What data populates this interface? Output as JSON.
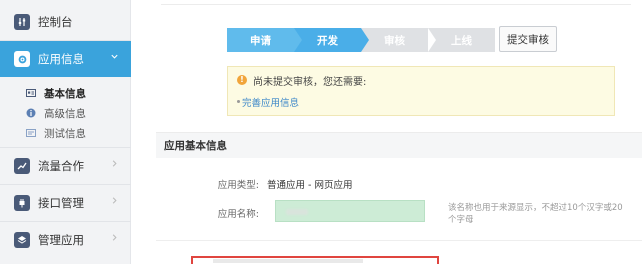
{
  "sidebar": {
    "items": [
      {
        "label": "控制台",
        "icon": "sliders-icon"
      },
      {
        "label": "应用信息",
        "icon": "gear-icon"
      },
      {
        "label": "流量合作",
        "icon": "chart-icon"
      },
      {
        "label": "接口管理",
        "icon": "plug-icon"
      },
      {
        "label": "管理应用",
        "icon": "layers-icon"
      }
    ],
    "sub_items": [
      {
        "label": "基本信息",
        "icon": "id-card-icon"
      },
      {
        "label": "高级信息",
        "icon": "info-icon"
      },
      {
        "label": "测试信息",
        "icon": "test-card-icon"
      }
    ]
  },
  "steps": [
    "申请",
    "开发",
    "审核",
    "上线"
  ],
  "submit_button": "提交审核",
  "notice": {
    "title": "尚未提交审核，您还需要:",
    "link": "完善应用信息"
  },
  "section": {
    "title": "应用基本信息",
    "type_label": "应用类型:",
    "type_value": "普通应用  -  网页应用",
    "name_label": "应用名称:",
    "name_hint": "该名称也用于来源显示，不超过10个汉字或20个字母"
  },
  "colors": {
    "accent": "#3aa3dc",
    "step_done": "#60bbec",
    "step_todo": "#dfe1e4",
    "notice_bg": "#fdfbe3",
    "highlight_red": "#e0453f",
    "input_green": "#cdecd6"
  }
}
